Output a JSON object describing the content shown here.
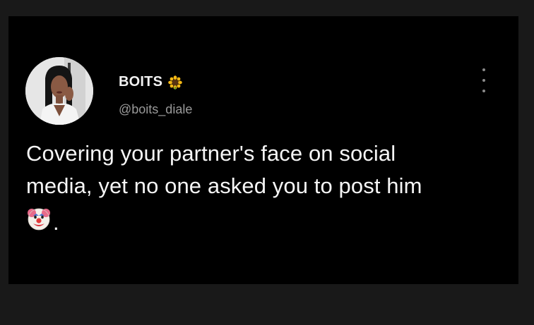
{
  "tweet": {
    "display_name": "BOITS",
    "name_emoji": "sunflower-icon",
    "handle": "@boits_diale",
    "text_lines": [
      "Covering your partner's face on social",
      "media, yet no one asked you to post him"
    ],
    "text_end_emoji": "clown-face-icon",
    "text_end": "."
  },
  "colors": {
    "background": "#000000",
    "frame": "#191919",
    "text_primary": "#f5f5f5",
    "text_secondary": "#9a9a9a"
  }
}
